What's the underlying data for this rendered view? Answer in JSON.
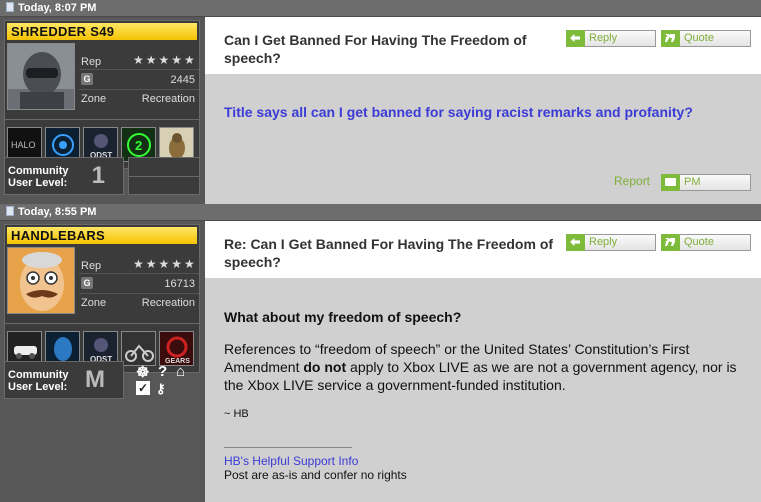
{
  "posts": [
    {
      "date": "Today, 8:07 PM",
      "gamertag": "SHREDDER S49",
      "rep_label": "Rep",
      "stars": "★★★★★",
      "gamerscore": "2445",
      "zone_label": "Zone",
      "zone": "Recreation",
      "community_label_1": "Community",
      "community_label_2": "User Level:",
      "community_level": "1",
      "title": "Can I Get Banned For Having The Freedom of speech?",
      "reply_label": "Reply",
      "quote_label": "Quote",
      "body": "Title says all can I get banned for saying racist remarks and profanity?",
      "report_label": "Report",
      "pm_label": "PM",
      "games": [
        "halo-2-icon",
        "halo-3-icon",
        "halo-3-odst-icon",
        "gears-2-icon",
        "fable-icon"
      ]
    },
    {
      "date": "Today, 8:55 PM",
      "gamertag": "HANDLEBARS",
      "rep_label": "Rep",
      "stars": "★★★★★",
      "gamerscore": "16713",
      "zone_label": "Zone",
      "zone": "Recreation",
      "community_label_1": "Community",
      "community_label_2": "User Level:",
      "community_level": "M",
      "title": "Re: Can I Get Banned For Having The Freedom of speech?",
      "reply_label": "Reply",
      "quote_label": "Quote",
      "heading": "What about my freedom of speech?",
      "body_pre": "References to “freedom of speech” or the United States’ Constitution’s First Amendment ",
      "body_bold": "do not",
      "body_post": " apply to Xbox LIVE as we are not a government agency, nor is the Xbox LIVE service a government-funded institution.",
      "signoff": "~ HB",
      "sig_link": "HB's Helpful Support Info",
      "sig_text": "Post are as-is and confer no rights",
      "games": [
        "car-game-icon",
        "halo-3-icon",
        "halo-3-odst-icon",
        "motocross-icon",
        "gears-of-war-icon"
      ]
    }
  ]
}
